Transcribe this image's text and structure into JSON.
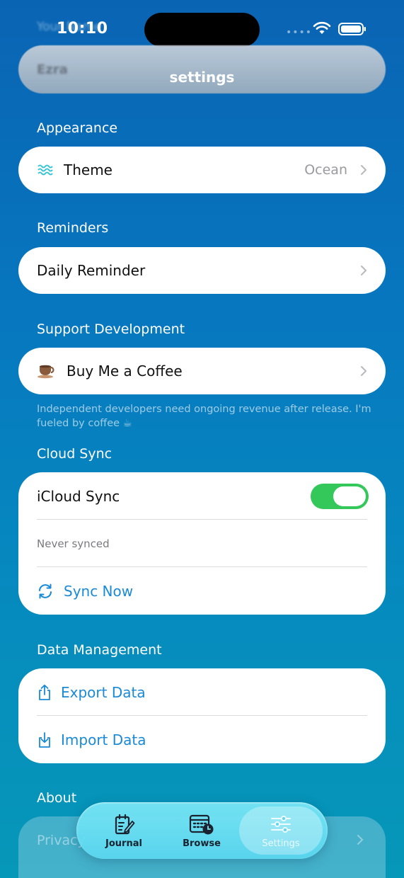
{
  "status_bar": {
    "time": "10:10"
  },
  "header": {
    "ghost_label": "Your Name",
    "ghost_value": "Ezra",
    "title": "settings"
  },
  "sections": {
    "appearance": {
      "title": "Appearance",
      "theme_label": "Theme",
      "theme_value": "Ocean"
    },
    "reminders": {
      "title": "Reminders",
      "daily_label": "Daily Reminder"
    },
    "support": {
      "title": "Support Development",
      "coffee_label": "Buy Me a Coffee",
      "footnote": "Independent developers need ongoing revenue after release. I'm fueled by coffee ☕"
    },
    "cloud_sync": {
      "title": "Cloud Sync",
      "icloud_label": "iCloud Sync",
      "icloud_on": true,
      "status": "Never synced",
      "sync_now": "Sync Now"
    },
    "data_management": {
      "title": "Data Management",
      "export": "Export Data",
      "import": "Import Data"
    },
    "about": {
      "title": "About",
      "privacy": "Privacy"
    }
  },
  "tabbar": {
    "tabs": [
      {
        "label": "Journal"
      },
      {
        "label": "Browse"
      },
      {
        "label": "Settings"
      }
    ]
  },
  "colors": {
    "accent_blue": "#1a8ad8",
    "toggle_green": "#34c759",
    "theme_icon": "#2ec4d6"
  }
}
